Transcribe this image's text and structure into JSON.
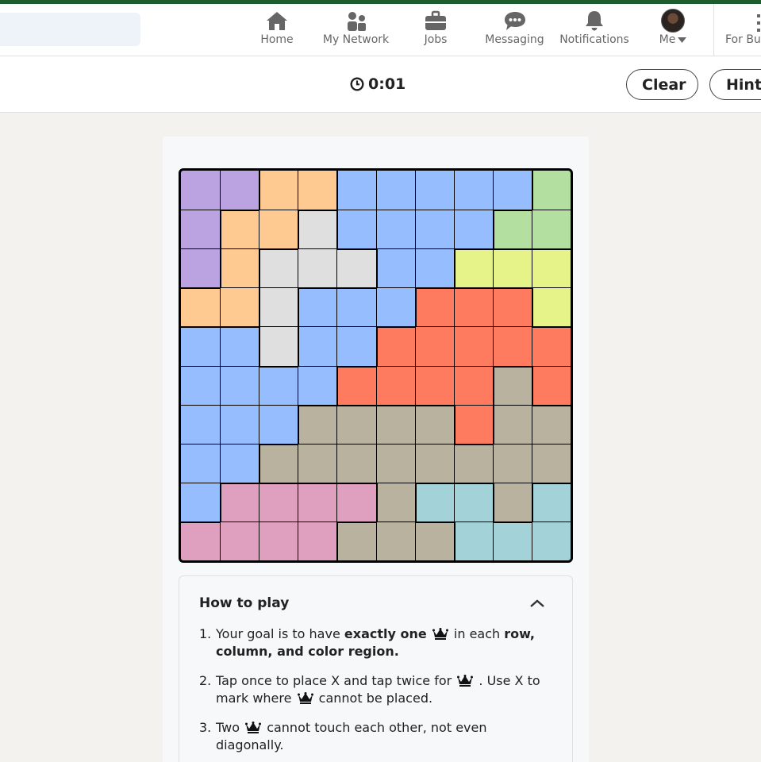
{
  "nav": {
    "items": [
      {
        "label": "Home",
        "icon": "home-icon"
      },
      {
        "label": "My Network",
        "icon": "network-icon"
      },
      {
        "label": "Jobs",
        "icon": "briefcase-icon"
      },
      {
        "label": "Messaging",
        "icon": "chat-icon"
      },
      {
        "label": "Notifications",
        "icon": "bell-icon"
      },
      {
        "label": "Me",
        "icon": "avatar"
      },
      {
        "label": "For Bu",
        "icon": "grid-icon"
      }
    ]
  },
  "game": {
    "timer": "0:01",
    "clear_label": "Clear",
    "hint_label": "Hint",
    "colors": {
      "P": "#bba3e2",
      "O": "#ffc992",
      "B": "#96beff",
      "G": "#b3dfa0",
      "W": "#dfdfdf",
      "Y": "#e6f388",
      "R": "#ff7b60",
      "T": "#b9b29e",
      "K": "#dfa0bf",
      "C": "#a3d2d8"
    },
    "grid": [
      [
        "P",
        "P",
        "O",
        "O",
        "B",
        "B",
        "B",
        "B",
        "B",
        "G"
      ],
      [
        "P",
        "O",
        "O",
        "W",
        "B",
        "B",
        "B",
        "B",
        "G",
        "G"
      ],
      [
        "P",
        "O",
        "W",
        "W",
        "W",
        "B",
        "B",
        "Y",
        "Y",
        "Y"
      ],
      [
        "O",
        "O",
        "W",
        "B",
        "B",
        "B",
        "R",
        "R",
        "R",
        "Y"
      ],
      [
        "B",
        "B",
        "W",
        "B",
        "B",
        "R",
        "R",
        "R",
        "R",
        "R"
      ],
      [
        "B",
        "B",
        "B",
        "B",
        "R",
        "R",
        "R",
        "R",
        "T",
        "R"
      ],
      [
        "B",
        "B",
        "B",
        "T",
        "T",
        "T",
        "T",
        "R",
        "T",
        "T"
      ],
      [
        "B",
        "B",
        "T",
        "T",
        "T",
        "T",
        "T",
        "T",
        "T",
        "T"
      ],
      [
        "B",
        "K",
        "K",
        "K",
        "K",
        "T",
        "C",
        "C",
        "T",
        "C"
      ],
      [
        "K",
        "K",
        "K",
        "K",
        "T",
        "T",
        "T",
        "C",
        "C",
        "C"
      ]
    ]
  },
  "howto": {
    "title": "How to play",
    "rule1_pre": "Your goal is to have ",
    "rule1_bold1": "exactly one",
    "rule1_mid": " in each ",
    "rule1_bold2": "row, column, and color region.",
    "rule2_pre": "Tap once to place X and tap twice for",
    "rule2_mid": ". Use X to mark where",
    "rule2_post": "cannot be placed.",
    "rule3_pre": "Two",
    "rule3_post": "cannot touch each other, not even diagonally."
  }
}
